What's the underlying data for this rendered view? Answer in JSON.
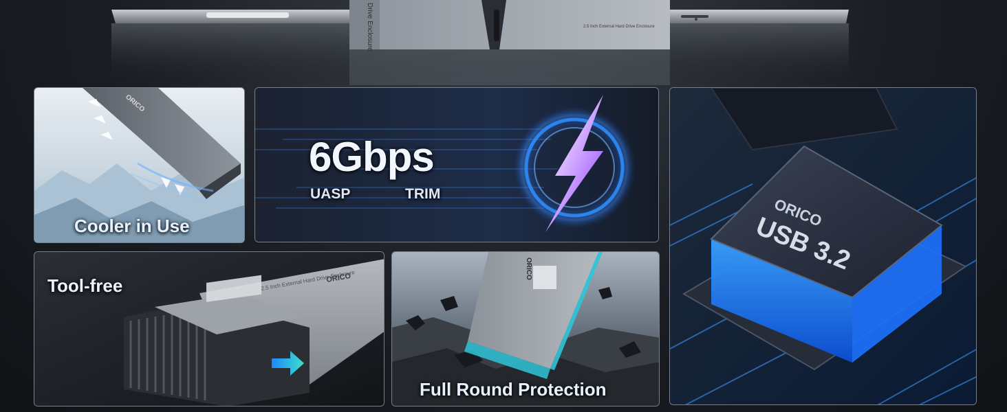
{
  "hero": {
    "enclosure_side_text": "Drive Enclosure",
    "enclosure_top_text": "2.5 Inch External Hard Drive Enclosure"
  },
  "panels": {
    "cooler": {
      "caption": "Cooler in Use",
      "brand": "ORICO"
    },
    "speed": {
      "headline": "6Gbps",
      "feature_1": "UASP",
      "feature_2": "TRIM"
    },
    "chip": {
      "brand": "ORICO",
      "label": "USB 3.2"
    },
    "toolfree": {
      "caption": "Tool-free",
      "brand": "ORICO",
      "body_text": "2.5 Inch External Hard Drive Enclosure"
    },
    "protection": {
      "caption": "Full Round Protection",
      "brand": "ORICO"
    }
  },
  "colors": {
    "accent_blue": "#2f8fff",
    "accent_purple": "#b45cff",
    "border": "#7a7f88"
  }
}
